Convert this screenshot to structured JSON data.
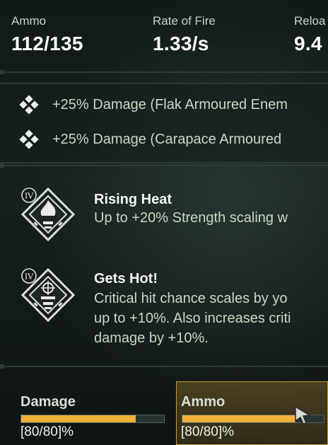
{
  "stats": [
    {
      "label": "Ammo",
      "value": "112/135"
    },
    {
      "label": "Rate of Fire",
      "value": "1.33/s"
    },
    {
      "label": "Reloa",
      "value": "9.4"
    }
  ],
  "bonuses": [
    {
      "text": "+25% Damage (Flak Armoured Enem",
      "icon": "diamond-cluster-icon"
    },
    {
      "text": "+25% Damage (Carapace Armoured",
      "icon": "diamond-cluster-icon"
    }
  ],
  "perks": [
    {
      "tier": "IV",
      "icon": "flame-emblem-icon",
      "title": "Rising Heat",
      "lines": [
        "Up to +20% Strength scaling w"
      ]
    },
    {
      "tier": "IV",
      "icon": "crosshair-emblem-icon",
      "title": "Gets Hot!",
      "lines": [
        "Critical hit chance scales by yo",
        "up to +10%. Also increases criti",
        "damage by +10%."
      ]
    }
  ],
  "bars": [
    {
      "name": "Damage",
      "amount": "[80/80]%",
      "fill": 0.8,
      "selected": false
    },
    {
      "name": "Ammo",
      "amount": "[80/80]%",
      "fill": 0.8,
      "selected": true
    }
  ],
  "colors": {
    "accent": "#f0b13a",
    "text_muted": "#c8d7c2",
    "selected_border": "#c59a3a"
  }
}
